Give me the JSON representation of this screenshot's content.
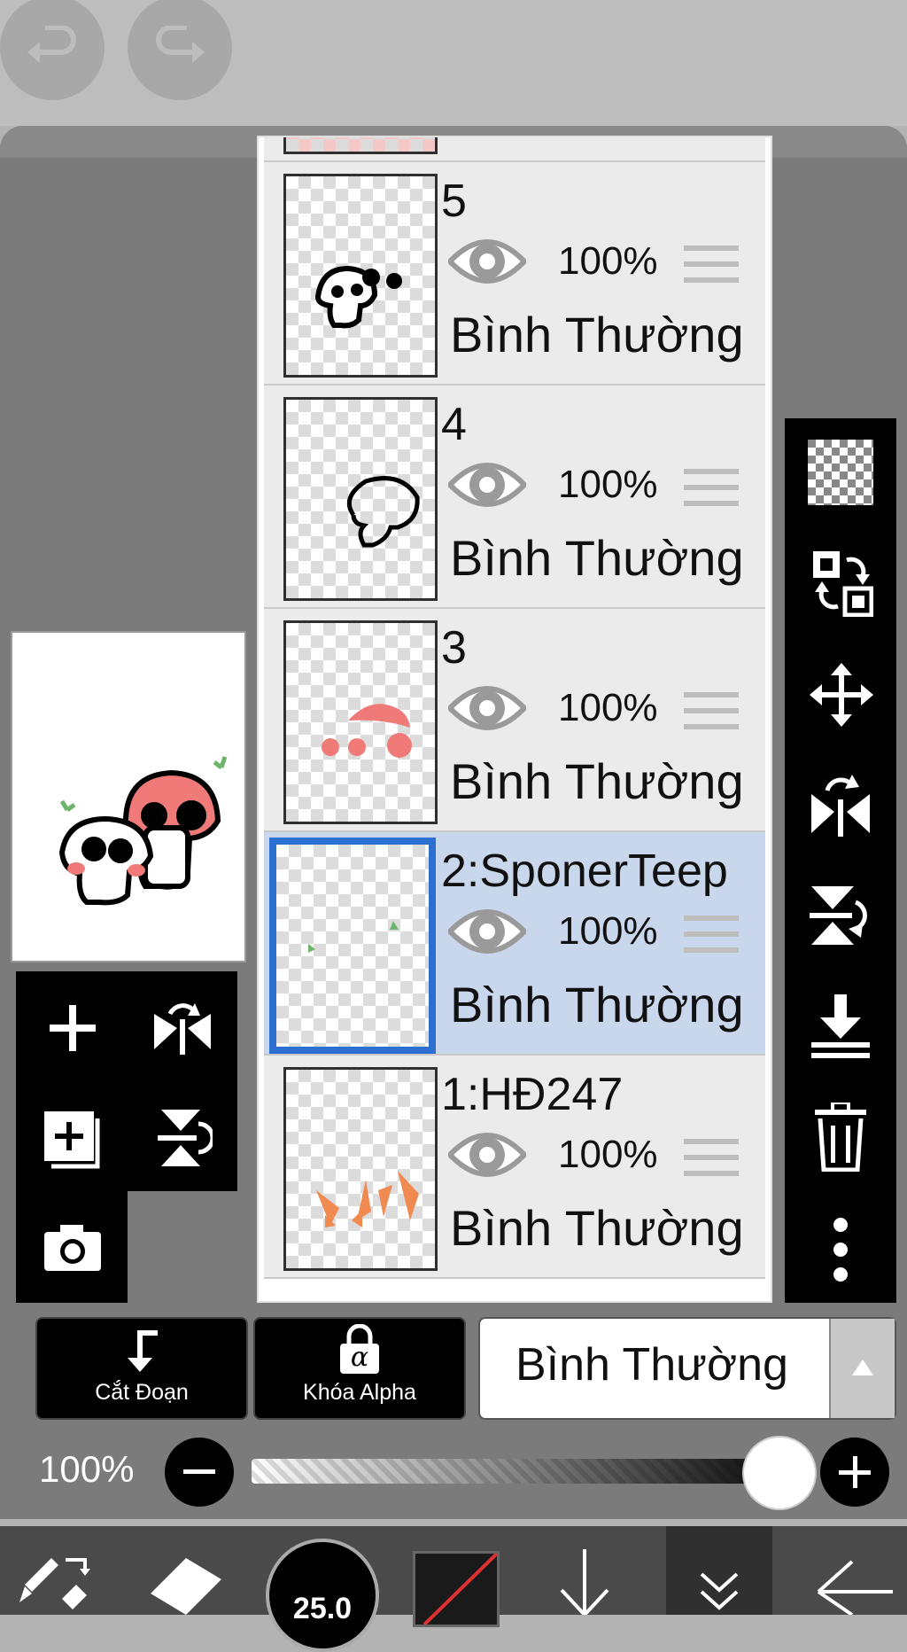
{
  "top_bar": {
    "undo_icon": "undo-icon",
    "redo_icon": "redo-icon"
  },
  "layers": [
    {
      "name": "5",
      "opacity": "100%",
      "blend": "Bình Thường",
      "selected": false
    },
    {
      "name": "4",
      "opacity": "100%",
      "blend": "Bình Thường",
      "selected": false
    },
    {
      "name": "3",
      "opacity": "100%",
      "blend": "Bình Thường",
      "selected": false
    },
    {
      "name": "2:SponerTeep",
      "opacity": "100%",
      "blend": "Bình Thường",
      "selected": true
    },
    {
      "name": "1:HĐ247",
      "opacity": "100%",
      "blend": "Bình Thường",
      "selected": false
    }
  ],
  "left_tools": [
    "add-layer-icon",
    "flip-horizontal-icon",
    "duplicate-layer-icon",
    "flip-vertical-icon",
    "camera-icon"
  ],
  "right_tools": [
    "transparent-bg-icon",
    "swap-layer-icon",
    "move-icon",
    "flip-horizontal-icon",
    "flip-vertical-icon",
    "merge-down-icon",
    "trash-icon",
    "more-icon"
  ],
  "controls": {
    "clipping_label": "Cắt Đoạn",
    "alpha_lock_label": "Khóa Alpha",
    "alpha_symbol": "α",
    "blend_mode": "Bình Thường",
    "opacity_label": "100%",
    "opacity_value": 1.0
  },
  "bottom_bar": {
    "brush_size": "25.0",
    "tools": [
      "brush-swap-icon",
      "eraser-icon",
      "brush-size-icon",
      "color-swatch-icon",
      "arrow-down-icon",
      "chevron-double-down-icon",
      "back-arrow-icon"
    ]
  },
  "colors": {
    "selection_blue": "#2d6fd1",
    "selected_row": "#c9d7ec",
    "mushroom_pink": "#f07a78"
  }
}
